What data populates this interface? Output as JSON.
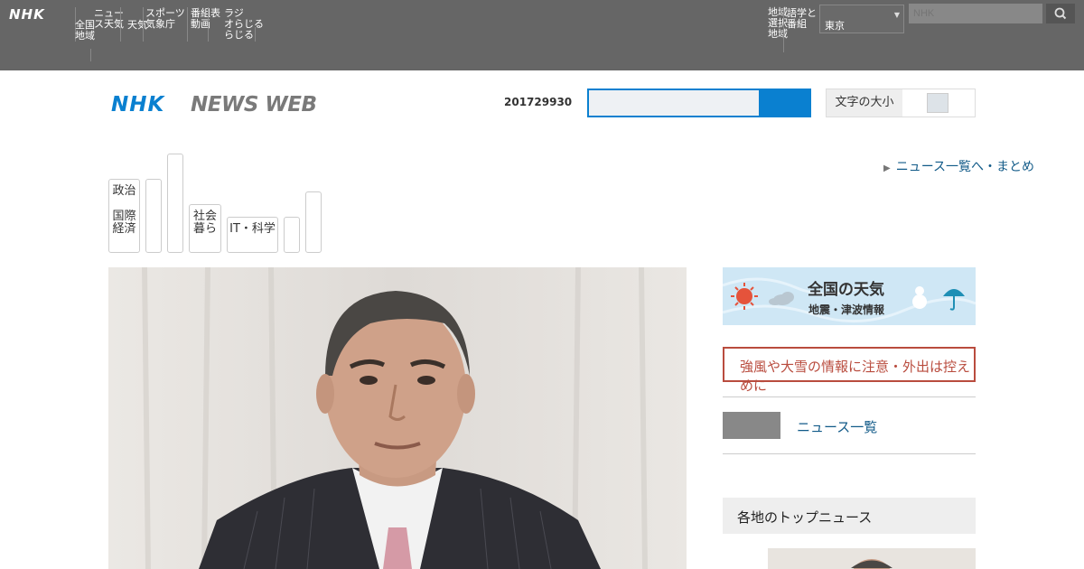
{
  "global_bar": {
    "logo": "NHK",
    "links": [
      {
        "text": "全国\n地域"
      },
      {
        "text": "ニュー\nス天気"
      },
      {
        "text": "天気"
      },
      {
        "text": "スポーツ\n気象庁"
      },
      {
        "text": "番組表\n動画"
      },
      {
        "text": "ラジ\nオらじる\nらじる"
      }
    ],
    "right_links": [
      {
        "text": "地域\n選択\n地域"
      },
      {
        "text": "語学と\n番組"
      }
    ],
    "region_select": "東京",
    "search_placeholder": "NHK"
  },
  "header": {
    "logo_nhk": "NHK",
    "logo_news_web": "NEWS WEB",
    "date": "201729930",
    "toggle_label": "文字の大小"
  },
  "categories": [
    {
      "label": "政治\n\n国際\n経済"
    },
    {
      "label": ""
    },
    {
      "label": ""
    },
    {
      "label": "社会\n暮ら"
    },
    {
      "label": "IT・科学"
    },
    {
      "label": ""
    },
    {
      "label": ""
    }
  ],
  "more_link": "ニュース一覧へ・まとめ",
  "sidebar": {
    "weather_title": "全国の天気",
    "weather_sub": "地震・津波情報",
    "alert_text": "強風や大雪の情報に注意・外出は控えめに",
    "link_label": "ニュース一覧",
    "section_head": "各地のトップニュース"
  },
  "colors": {
    "accent": "#0a80d0",
    "global_bar": "#666666",
    "alert": "#b94c3e",
    "link": "#115a88"
  }
}
